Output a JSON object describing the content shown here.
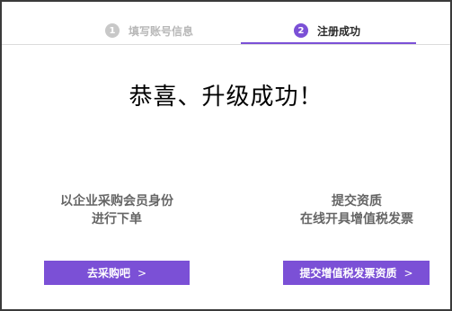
{
  "steps": [
    {
      "number": "1",
      "label": "填写账号信息"
    },
    {
      "number": "2",
      "label": "注册成功"
    }
  ],
  "title": "恭喜、升级成功！",
  "left": {
    "line1": "以企业采购会员身份",
    "line2": "进行下单",
    "button": "去采购吧",
    "button_icon": "chevron-right-icon"
  },
  "right": {
    "line1": "提交资质",
    "line2": "在线开具增值税发票",
    "button": "提交增值税发票资质",
    "button_icon": "chevron-right-icon"
  },
  "colors": {
    "accent": "#7b50d6",
    "inactive": "#c8c8c8",
    "text_muted": "#666666"
  }
}
